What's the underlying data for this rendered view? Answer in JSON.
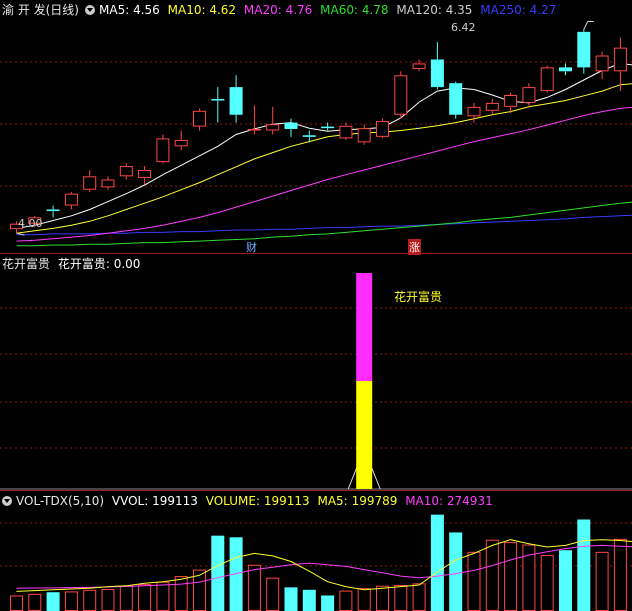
{
  "colors": {
    "up": "#ff4646",
    "down": "#54ffff",
    "ma5": "#ffffff",
    "ma10": "#ffff2e",
    "ma20": "#ff3cff",
    "ma60": "#2edf2e",
    "ma120": "#bbbbbb",
    "ma250": "#3a3aff",
    "grid": "#8b1a1a",
    "hfg_top": "#ff2cff",
    "hfg_bottom": "#ffff00"
  },
  "price_panel": {
    "title": "渝 开 发(日线)",
    "ma5": {
      "label": "MA5:",
      "value": "4.56"
    },
    "ma10": {
      "label": "MA10:",
      "value": "4.62"
    },
    "ma20": {
      "label": "MA20:",
      "value": "4.76"
    },
    "ma60": {
      "label": "MA60:",
      "value": "4.78"
    },
    "ma120": {
      "label": "MA120:",
      "value": "4.35"
    },
    "ma250": {
      "label": "MA250:",
      "value": "4.27"
    },
    "high_label": "6.42",
    "low_label": "4.00",
    "marker_cai": "财",
    "marker_zhang": "涨"
  },
  "indicator_panel": {
    "title": "花开富贵",
    "value_label": "花开富贵:",
    "value": "0.00",
    "bar_label": "花开富贵"
  },
  "volume_panel": {
    "title": "VOL-TDX(5,10)",
    "vvol": {
      "label": "VVOL:",
      "value": "199113"
    },
    "volume": {
      "label": "VOLUME:",
      "value": "199113"
    },
    "ma5": {
      "label": "MA5:",
      "value": "199789"
    },
    "ma10": {
      "label": "MA10:",
      "value": "274931"
    }
  },
  "chart_data": {
    "type": "candlestick",
    "candles": [
      {
        "o": 4.05,
        "c": 4.12,
        "h": 4.15,
        "l": 4.0
      },
      {
        "o": 4.12,
        "c": 4.2,
        "h": 4.22,
        "l": 4.08
      },
      {
        "o": 4.3,
        "c": 4.28,
        "h": 4.35,
        "l": 4.2
      },
      {
        "o": 4.35,
        "c": 4.5,
        "h": 4.52,
        "l": 4.3
      },
      {
        "o": 4.55,
        "c": 4.72,
        "h": 4.8,
        "l": 4.52
      },
      {
        "o": 4.58,
        "c": 4.68,
        "h": 4.72,
        "l": 4.55
      },
      {
        "o": 4.72,
        "c": 4.85,
        "h": 4.88,
        "l": 4.68
      },
      {
        "o": 4.7,
        "c": 4.8,
        "h": 4.85,
        "l": 4.62
      },
      {
        "o": 4.9,
        "c": 5.2,
        "h": 5.25,
        "l": 4.88
      },
      {
        "o": 5.1,
        "c": 5.18,
        "h": 5.3,
        "l": 5.05
      },
      {
        "o": 5.35,
        "c": 5.55,
        "h": 5.58,
        "l": 5.3
      },
      {
        "o": 5.7,
        "c": 5.68,
        "h": 5.85,
        "l": 5.4
      },
      {
        "o": 5.85,
        "c": 5.5,
        "h": 6.0,
        "l": 5.4
      },
      {
        "o": 5.3,
        "c": 5.32,
        "h": 5.62,
        "l": 5.25
      },
      {
        "o": 5.3,
        "c": 5.38,
        "h": 5.6,
        "l": 5.25
      },
      {
        "o": 5.4,
        "c": 5.32,
        "h": 5.45,
        "l": 5.22
      },
      {
        "o": 5.24,
        "c": 5.22,
        "h": 5.3,
        "l": 5.15
      },
      {
        "o": 5.35,
        "c": 5.33,
        "h": 5.4,
        "l": 5.3
      },
      {
        "o": 5.2,
        "c": 5.36,
        "h": 5.4,
        "l": 5.18
      },
      {
        "o": 5.15,
        "c": 5.33,
        "h": 5.38,
        "l": 5.12
      },
      {
        "o": 5.22,
        "c": 5.42,
        "h": 5.45,
        "l": 5.2
      },
      {
        "o": 5.5,
        "c": 6.0,
        "h": 6.05,
        "l": 5.45
      },
      {
        "o": 6.08,
        "c": 6.15,
        "h": 6.2,
        "l": 6.05
      },
      {
        "o": 6.2,
        "c": 5.85,
        "h": 6.42,
        "l": 5.82
      },
      {
        "o": 5.9,
        "c": 5.5,
        "h": 5.92,
        "l": 5.45
      },
      {
        "o": 5.48,
        "c": 5.6,
        "h": 5.65,
        "l": 5.4
      },
      {
        "o": 5.55,
        "c": 5.65,
        "h": 5.7,
        "l": 5.5
      },
      {
        "o": 5.6,
        "c": 5.75,
        "h": 5.78,
        "l": 5.52
      },
      {
        "o": 5.65,
        "c": 5.85,
        "h": 5.9,
        "l": 5.6
      },
      {
        "o": 5.8,
        "c": 6.1,
        "h": 6.12,
        "l": 5.78
      },
      {
        "o": 6.1,
        "c": 6.05,
        "h": 6.15,
        "l": 6.0
      },
      {
        "o": 6.55,
        "c": 6.1,
        "h": 6.58,
        "l": 6.02
      },
      {
        "o": 6.05,
        "c": 6.25,
        "h": 6.3,
        "l": 5.95
      },
      {
        "o": 6.05,
        "c": 6.35,
        "h": 6.48,
        "l": 5.8
      },
      {
        "o": 6.25,
        "c": 5.9,
        "h": 6.35,
        "l": 5.85
      }
    ],
    "ma5": [
      4.06,
      4.1,
      4.16,
      4.22,
      4.3,
      4.4,
      4.5,
      4.61,
      4.74,
      4.86,
      4.98,
      5.1,
      5.25,
      5.32,
      5.38,
      5.4,
      5.33,
      5.29,
      5.31,
      5.32,
      5.34,
      5.46,
      5.66,
      5.8,
      5.84,
      5.82,
      5.75,
      5.67,
      5.65,
      5.72,
      5.82,
      5.94,
      6.06,
      6.15,
      6.12
    ],
    "ma10": [
      4.0,
      4.03,
      4.06,
      4.1,
      4.15,
      4.22,
      4.3,
      4.38,
      4.46,
      4.55,
      4.64,
      4.74,
      4.84,
      4.94,
      5.02,
      5.1,
      5.16,
      5.22,
      5.25,
      5.27,
      5.28,
      5.3,
      5.33,
      5.36,
      5.4,
      5.45,
      5.5,
      5.54,
      5.6,
      5.64,
      5.68,
      5.74,
      5.8,
      5.88,
      5.9
    ],
    "ma20": [
      3.9,
      3.91,
      3.93,
      3.95,
      3.97,
      4.0,
      4.03,
      4.06,
      4.1,
      4.15,
      4.2,
      4.26,
      4.33,
      4.4,
      4.47,
      4.54,
      4.61,
      4.68,
      4.74,
      4.8,
      4.86,
      4.92,
      4.98,
      5.04,
      5.1,
      5.16,
      5.21,
      5.26,
      5.31,
      5.37,
      5.43,
      5.49,
      5.54,
      5.58,
      5.6
    ],
    "ma60": [
      3.84,
      3.84,
      3.85,
      3.85,
      3.86,
      3.86,
      3.87,
      3.88,
      3.88,
      3.89,
      3.9,
      3.91,
      3.92,
      3.93,
      3.95,
      3.96,
      3.98,
      3.99,
      4.01,
      4.03,
      4.05,
      4.07,
      4.09,
      4.11,
      4.13,
      4.16,
      4.18,
      4.2,
      4.23,
      4.26,
      4.29,
      4.32,
      4.35,
      4.38,
      4.4
    ],
    "ma250": [
      3.98,
      3.98,
      3.99,
      3.99,
      3.99,
      4.0,
      4.0,
      4.01,
      4.01,
      4.02,
      4.02,
      4.03,
      4.04,
      4.04,
      4.05,
      4.05,
      4.06,
      4.07,
      4.07,
      4.08,
      4.09,
      4.09,
      4.1,
      4.11,
      4.12,
      4.13,
      4.14,
      4.15,
      4.16,
      4.17,
      4.18,
      4.2,
      4.21,
      4.22,
      4.23
    ],
    "volume": [
      180000,
      200000,
      220000,
      230000,
      250000,
      260000,
      300000,
      320000,
      350000,
      420000,
      500000,
      920000,
      900000,
      560000,
      400000,
      280000,
      250000,
      180000,
      240000,
      270000,
      300000,
      310000,
      330000,
      1180000,
      960000,
      720000,
      870000,
      840000,
      810000,
      680000,
      740000,
      1120000,
      720000,
      880000,
      730000
    ],
    "vol_ma5": [
      230000,
      240000,
      250000,
      260000,
      270000,
      290000,
      300000,
      330000,
      350000,
      380000,
      430000,
      550000,
      650000,
      700000,
      670000,
      600000,
      480000,
      350000,
      290000,
      250000,
      270000,
      290000,
      310000,
      470000,
      620000,
      700000,
      800000,
      870000,
      820000,
      780000,
      800000,
      860000,
      870000,
      860000,
      840000
    ],
    "vol_ma10": [
      270000,
      272000,
      274000,
      277000,
      280000,
      285000,
      292000,
      300000,
      310000,
      320000,
      345000,
      400000,
      450000,
      500000,
      530000,
      560000,
      580000,
      560000,
      540000,
      500000,
      460000,
      420000,
      400000,
      420000,
      450000,
      490000,
      550000,
      620000,
      680000,
      720000,
      760000,
      790000,
      800000,
      790000,
      780000
    ],
    "hfg_signal_index": 19,
    "price_range": [
      3.85,
      6.7
    ],
    "volume_max": 1250000
  }
}
